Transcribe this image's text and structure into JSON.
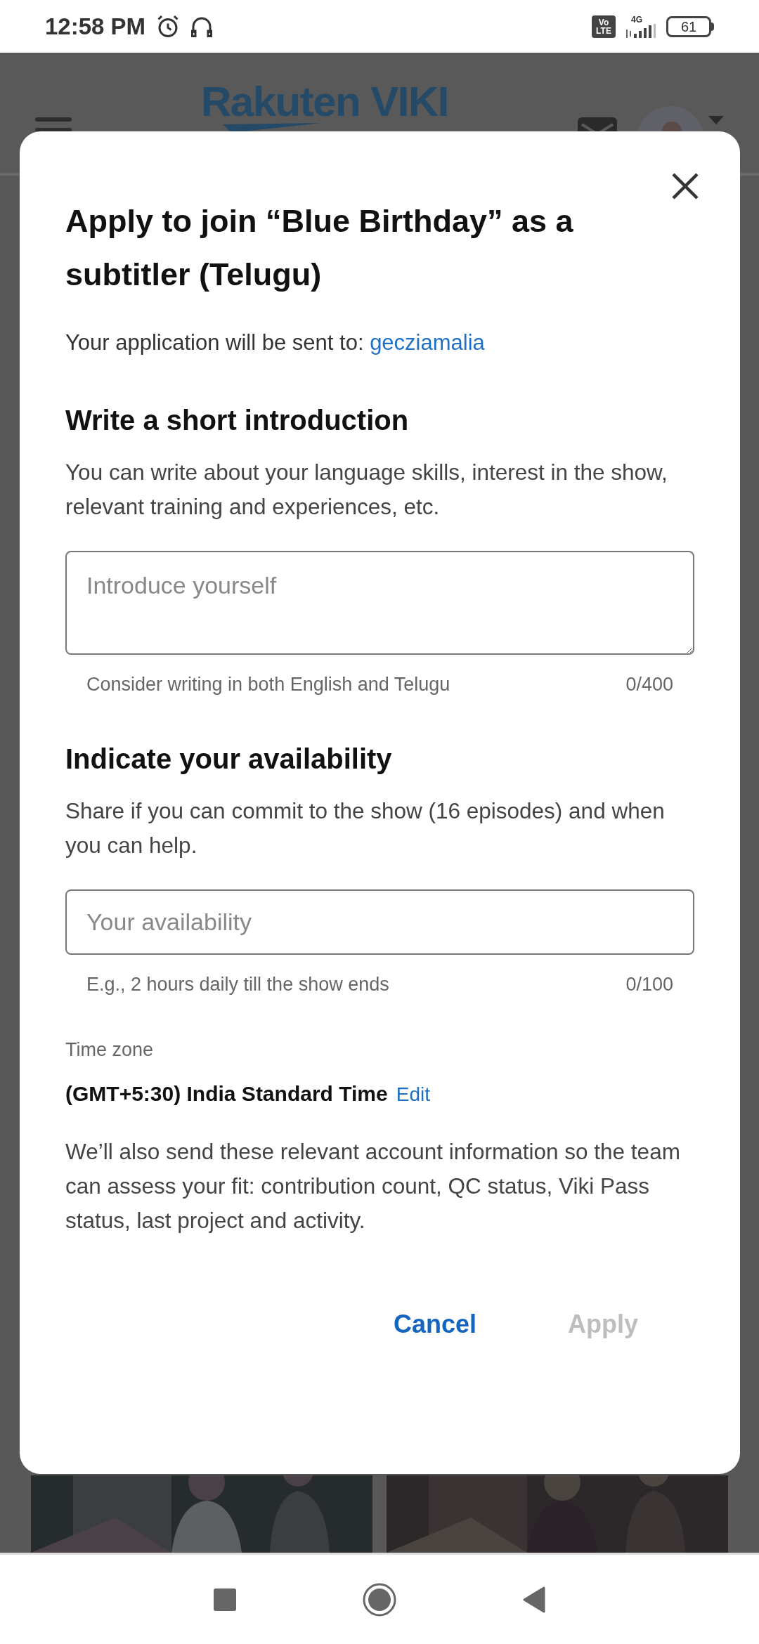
{
  "status_bar": {
    "time": "12:58 PM",
    "volte_top": "Vo",
    "volte_bottom": "LTE",
    "network": "4G",
    "battery": "61"
  },
  "header": {
    "logo": "Rakuten VIKI"
  },
  "dialog": {
    "title": "Apply to join “Blue Birthday” as a subtitler (Telugu)",
    "recipient_label": "Your application will be sent to:",
    "recipient": "gecziamalia",
    "sections": [
      {
        "heading": "Write a short introduction",
        "description": "You can write about your language skills, interest in the show, relevant training and experiences, etc.",
        "field": {
          "placeholder": "Introduce yourself",
          "multiline": true
        },
        "hint": "Consider writing in both English and Telugu",
        "counter": "0/400"
      },
      {
        "heading": "Indicate your availability",
        "description": "Share if you can commit to the show (16 episodes) and when you can help.",
        "field": {
          "placeholder": "Your availability",
          "multiline": false
        },
        "hint": "E.g., 2 hours daily till the show ends",
        "counter": "0/100"
      }
    ],
    "time_zone": {
      "label": "Time zone",
      "value": "(GMT+5:30) India Standard Time",
      "edit": "Edit"
    },
    "note": "We’ll also send these relevant account information so the team can assess your fit: contribution count, QC status, Viki Pass status, last project and activity.",
    "buttons": [
      {
        "label": "Cancel",
        "disabled": false
      },
      {
        "label": "Apply",
        "disabled": true
      }
    ]
  }
}
